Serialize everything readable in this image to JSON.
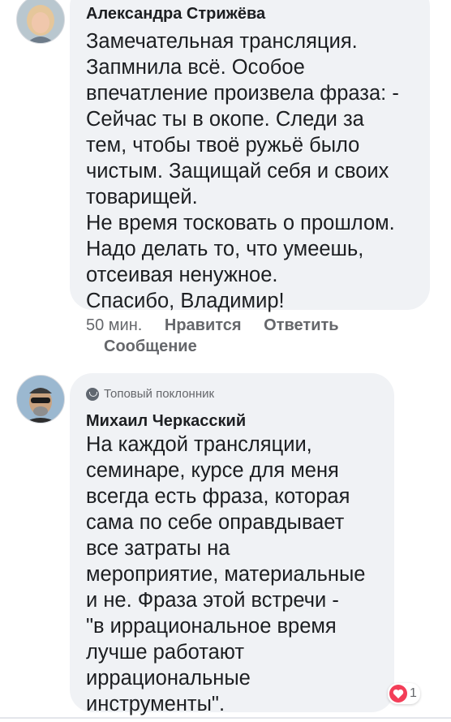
{
  "comments": [
    {
      "author": "Александра Стрижёва",
      "lines": [
        "Замечательная трансляция.",
        "Запмнила всё. Особое",
        "впечатление произвела фраза: -",
        "Сейчас ты в окопе. Следи за",
        "тем, чтобы твоё ружьё было",
        "чистым. Защищай себя и своих",
        "товарищей.",
        "Не время тосковать о прошлом.",
        "Надо делать то, что умеешь,",
        "отсеивая ненужное.",
        "Спасибо, Владимир!"
      ],
      "time": "50 мин.",
      "like_label": "Нравится",
      "reply_label": "Ответить",
      "message_label": "Сообщение"
    },
    {
      "badge": "Топовый поклонник",
      "author": "Михаил Черкасский",
      "lines": [
        "На каждой трансляции,",
        "семинаре, курсе для меня",
        "всегда есть фраза, которая",
        "сама по себе оправдывает",
        "все затраты на",
        "мероприятие, материальные",
        "и не. Фраза этой встречи -",
        "\"в иррациональное время",
        "лучше работают",
        "иррациональные",
        "инструменты\"."
      ],
      "reaction": {
        "icon": "heart-icon",
        "count": "1"
      }
    }
  ],
  "colors": {
    "bubble": "#f0f2f5",
    "meta_text": "#65676b",
    "heart": "#f33e58"
  }
}
